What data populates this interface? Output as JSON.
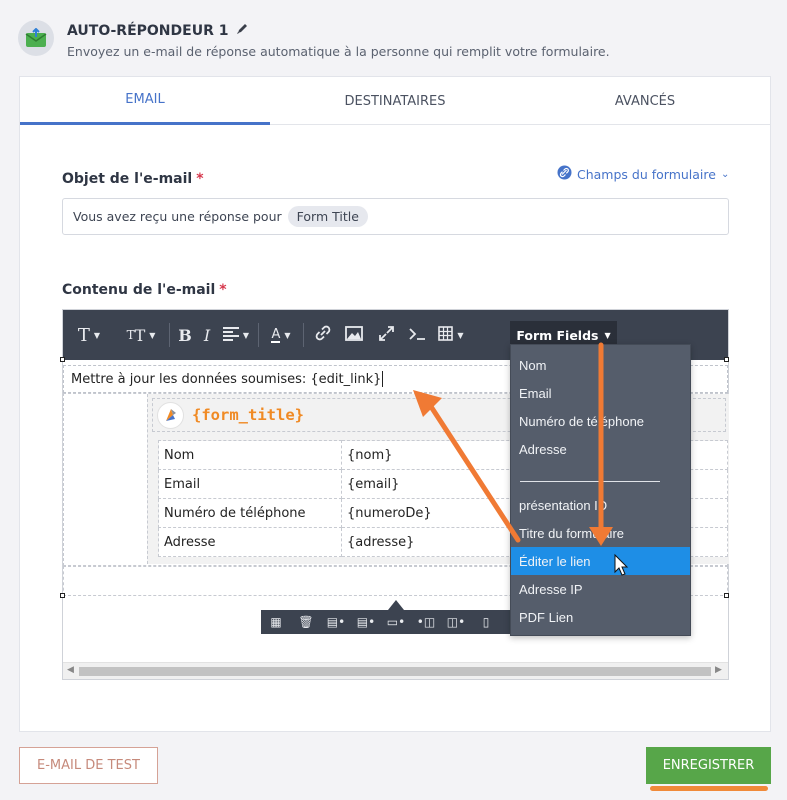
{
  "header": {
    "title": "AUTO-RÉPONDEUR 1",
    "subtitle": "Envoyez un e-mail de réponse automatique à la personne qui remplit votre formulaire."
  },
  "tabs": [
    {
      "label": "EMAIL",
      "active": true
    },
    {
      "label": "DESTINATAIRES",
      "active": false
    },
    {
      "label": "AVANCÉS",
      "active": false
    }
  ],
  "subject": {
    "label": "Objet de l'e-mail",
    "required_mark": "*",
    "fields_link": "Champs du formulaire",
    "text": "Vous avez reçu une réponse pour",
    "tag": "Form Title"
  },
  "content": {
    "label": "Contenu de l'e-mail",
    "required_mark": "*",
    "toolbar": {
      "form_fields_label": "Form Fields"
    },
    "line_text": "Mettre à jour les données soumises: {edit_link}",
    "form_title": "{form_title}",
    "rows": [
      {
        "key": "Nom",
        "value": "{nom}"
      },
      {
        "key": "Email",
        "value": "{email}"
      },
      {
        "key": "Numéro de téléphone",
        "value": "{numeroDe}"
      },
      {
        "key": "Adresse",
        "value": "{adresse}"
      }
    ]
  },
  "dropdown": {
    "items": [
      "Nom",
      "Email",
      "Numéro de téléphone",
      "Adresse",
      "présentation ID",
      "Titre du formulaire",
      "Éditer le lien",
      "Adresse IP",
      "PDF Lien"
    ],
    "selected": "Éditer le lien"
  },
  "footer": {
    "test_button": "E-MAIL DE TEST",
    "save_button": "ENREGISTRER"
  },
  "colors": {
    "accent": "#4673c9",
    "save_green": "#57a649",
    "annotation_orange": "#f07a34",
    "dropdown_selected": "#1e8ee6",
    "toolbar_dark": "#3c4350"
  }
}
